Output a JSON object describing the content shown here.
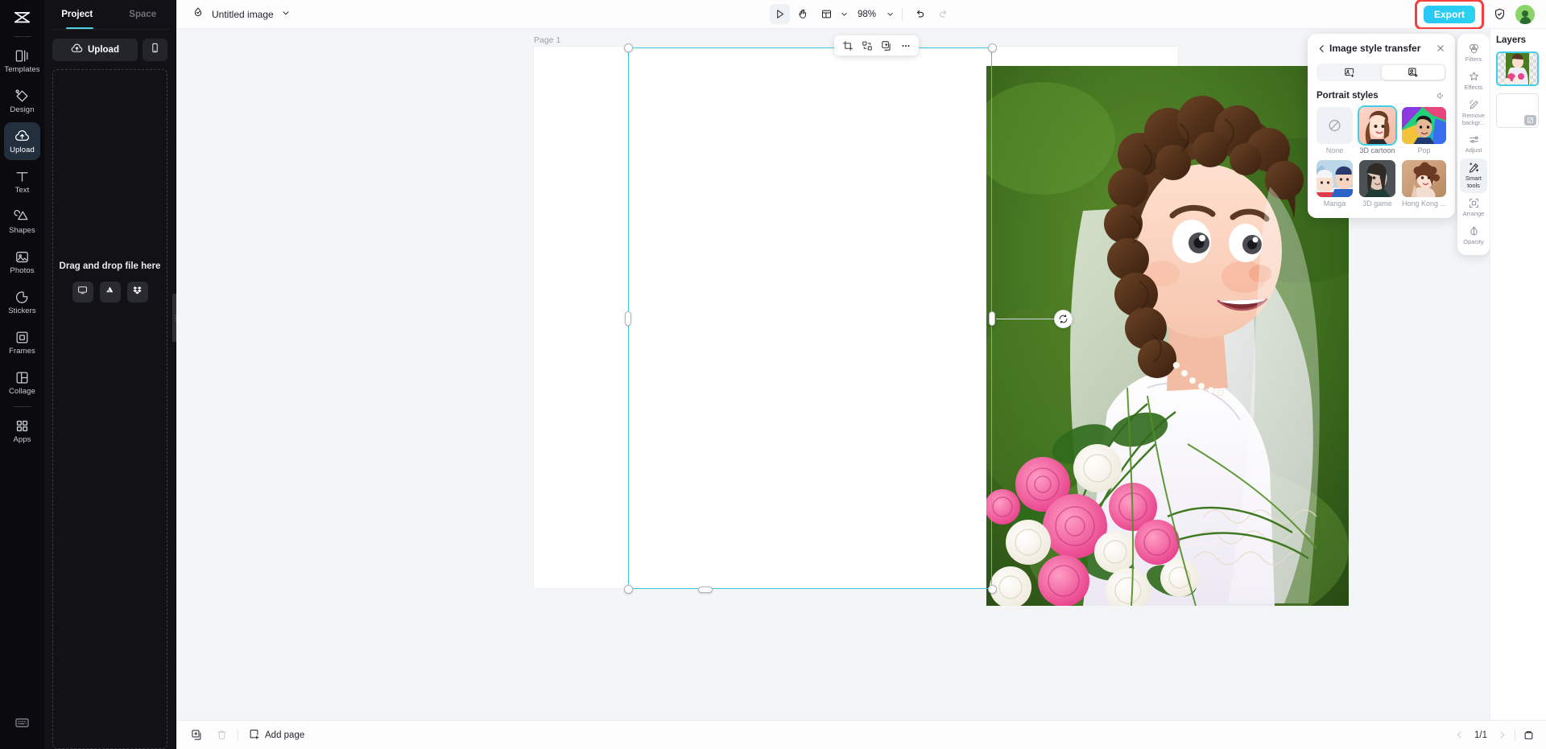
{
  "app": {
    "brand": "capcut-logo"
  },
  "rail": {
    "items": [
      {
        "label": "Templates",
        "icon": "templates-icon",
        "active": false
      },
      {
        "label": "Design",
        "icon": "design-icon",
        "active": false
      },
      {
        "label": "Upload",
        "icon": "upload-cloud-icon",
        "active": true
      },
      {
        "label": "Text",
        "icon": "text-icon",
        "active": false
      },
      {
        "label": "Shapes",
        "icon": "shapes-icon",
        "active": false
      },
      {
        "label": "Photos",
        "icon": "photos-icon",
        "active": false
      },
      {
        "label": "Stickers",
        "icon": "stickers-icon",
        "active": false
      },
      {
        "label": "Frames",
        "icon": "frames-icon",
        "active": false
      },
      {
        "label": "Collage",
        "icon": "collage-icon",
        "active": false
      },
      {
        "label": "Apps",
        "icon": "apps-grid-icon",
        "active": false
      }
    ],
    "bottom_icon": "keyboard-shortcuts-icon"
  },
  "left_panel": {
    "tabs": [
      {
        "label": "Project",
        "active": true
      },
      {
        "label": "Space",
        "active": false
      }
    ],
    "upload_label": "Upload",
    "upload_icon": "upload-cloud-icon",
    "phone_icon": "mobile-device-icon",
    "dropzone": {
      "title": "Drag and drop file here",
      "sources": [
        {
          "icon": "computer-monitor-icon",
          "name": "from-computer"
        },
        {
          "icon": "google-drive-icon",
          "name": "from-google-drive"
        },
        {
          "icon": "dropbox-icon",
          "name": "from-dropbox"
        }
      ]
    }
  },
  "topbar": {
    "doc_icon": "capcut-doc-icon",
    "doc_title": "Untitled image",
    "chevron": "chevron-down-icon",
    "tools": [
      {
        "name": "select-tool",
        "icon": "cursor-arrow-icon",
        "active": true
      },
      {
        "name": "hand-tool",
        "icon": "hand-icon",
        "active": false
      },
      {
        "name": "layout-tool",
        "icon": "layout-panel-icon",
        "active": false
      }
    ],
    "zoom_level": "98%",
    "undo_icon": "undo-icon",
    "redo_icon": "redo-icon",
    "export_label": "Export",
    "shield_icon": "shield-check-icon",
    "avatar": "user-avatar"
  },
  "canvas": {
    "page_label": "Page 1",
    "float_toolbar": [
      {
        "name": "crop-button",
        "icon": "crop-icon"
      },
      {
        "name": "replace-button",
        "icon": "replace-image-icon"
      },
      {
        "name": "duplicate-button",
        "icon": "duplicate-icon"
      },
      {
        "name": "more-button",
        "icon": "more-horizontal-icon"
      }
    ],
    "rotate_icon": "rotate-handle-icon",
    "image_alt": "3D-cartoon-style bride holding pink and white rose bouquet"
  },
  "style_panel": {
    "back_icon": "chevron-left-icon",
    "title": "Image style transfer",
    "close_icon": "close-icon",
    "segments": [
      {
        "name": "image-to-image-tab",
        "icon": "image-plus-icon",
        "active": false
      },
      {
        "name": "portrait-style-tab",
        "icon": "portrait-plus-icon",
        "active": true
      }
    ],
    "section_title": "Portrait styles",
    "section_action_icon": "compare-icon",
    "styles": [
      {
        "label": "None",
        "thumb": "none-slash",
        "selected": false
      },
      {
        "label": "3D cartoon",
        "thumb": "thumb-3d-cartoon",
        "selected": true
      },
      {
        "label": "Pop",
        "thumb": "thumb-pop",
        "selected": false
      },
      {
        "label": "Manga",
        "thumb": "thumb-manga",
        "selected": false
      },
      {
        "label": "3D game",
        "thumb": "thumb-3d-game",
        "selected": false
      },
      {
        "label": "Hong Kong ...",
        "thumb": "thumb-hongkong",
        "selected": false
      }
    ]
  },
  "tool_rail": {
    "items": [
      {
        "label": "Filters",
        "icon": "filters-icon",
        "active": false
      },
      {
        "label": "Effects",
        "icon": "effects-icon",
        "active": false
      },
      {
        "label": "Remove backgr...",
        "icon": "remove-background-icon",
        "active": false
      },
      {
        "label": "Adjust",
        "icon": "adjust-sliders-icon",
        "active": false
      },
      {
        "label": "Smart tools",
        "icon": "smart-tools-wand-icon",
        "active": true
      },
      {
        "label": "Arrange",
        "icon": "arrange-icon",
        "active": false
      },
      {
        "label": "Opacity",
        "icon": "opacity-drop-icon",
        "active": false
      }
    ]
  },
  "layers": {
    "title": "Layers",
    "items": [
      {
        "name": "layer-image",
        "type": "image",
        "selected": true
      },
      {
        "name": "layer-background",
        "type": "background",
        "selected": false
      }
    ]
  },
  "bottombar": {
    "buttons": [
      {
        "name": "duplicate-page-button",
        "icon": "duplicate-page-icon",
        "enabled": true
      },
      {
        "name": "delete-page-button",
        "icon": "trash-icon",
        "enabled": false
      }
    ],
    "add_page_label": "Add page",
    "add_page_icon": "add-page-icon",
    "prev_icon": "chevron-left-icon",
    "page_indicator": "1/1",
    "next_icon": "chevron-right-icon",
    "grid_view_icon": "page-manager-icon"
  },
  "colors": {
    "accent_cyan": "#3fcfe6",
    "export_gradient_start": "#29c5f6",
    "export_gradient_end": "#2ad3ef",
    "highlight_red": "#f43f3f",
    "rail_bg": "#0b0b0f",
    "panel_bg": "#121216",
    "canvas_bg": "#f3f5f7"
  }
}
